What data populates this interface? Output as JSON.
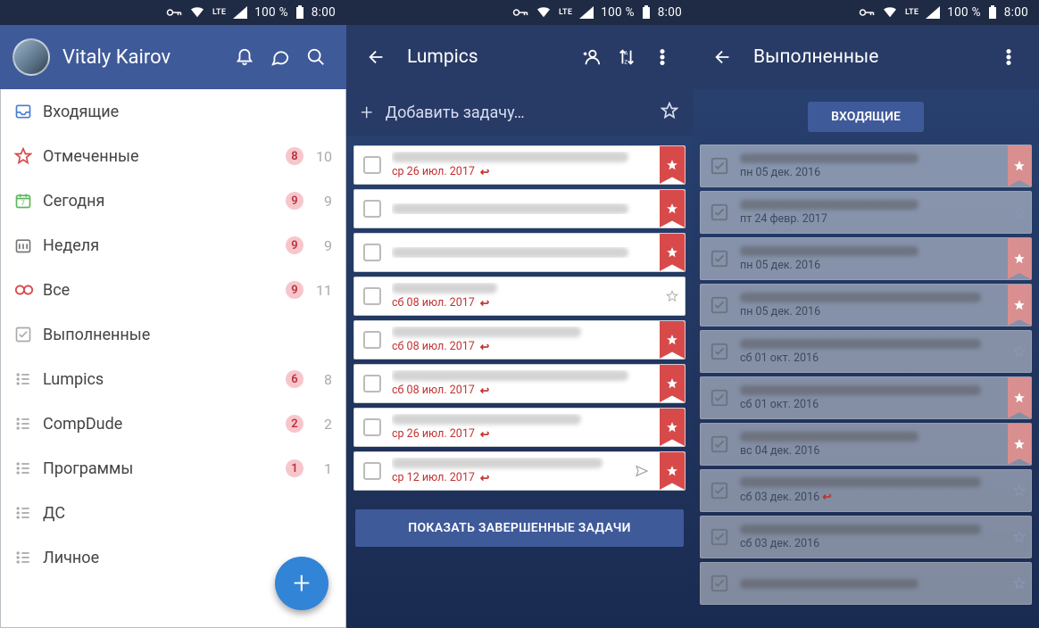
{
  "statusbar": {
    "lte": "LTE",
    "signal": "100 %",
    "time": "8:00"
  },
  "p1": {
    "user": "Vitaly Kairov",
    "sections": [
      {
        "icon": "inbox",
        "iconColor": "#4a7bd0",
        "label": "Входящие"
      },
      {
        "icon": "star",
        "iconColor": "#d84a4a",
        "label": "Отмеченные",
        "badge": "8",
        "count": "10"
      },
      {
        "icon": "today",
        "iconColor": "#5cb85c",
        "label": "Сегодня",
        "badge": "9",
        "count": "9"
      },
      {
        "icon": "week",
        "iconColor": "#888",
        "label": "Неделя",
        "badge": "9",
        "count": "9"
      },
      {
        "icon": "all",
        "iconColor": "#d84a4a",
        "label": "Все",
        "badge": "9",
        "count": "11"
      },
      {
        "icon": "done",
        "iconColor": "#aaa",
        "label": "Выполненные"
      },
      {
        "icon": "list",
        "iconColor": "#aaa",
        "label": "Lumpics",
        "badge": "6",
        "count": "8"
      },
      {
        "icon": "list",
        "iconColor": "#aaa",
        "label": "CompDude",
        "badge": "2",
        "count": "2"
      },
      {
        "icon": "list",
        "iconColor": "#aaa",
        "label": "Программы",
        "badge": "1",
        "count": "1"
      },
      {
        "icon": "list",
        "iconColor": "#aaa",
        "label": "ДС"
      },
      {
        "icon": "list",
        "iconColor": "#aaa",
        "label": "Личное"
      }
    ]
  },
  "p2": {
    "title": "Lumpics",
    "add": "Добавить задачу…",
    "tasks": [
      {
        "date": "ср 26 июл. 2017",
        "repeat": true,
        "star": "red",
        "blur": "long"
      },
      {
        "date": "",
        "repeat": false,
        "star": "red",
        "blur": "long"
      },
      {
        "date": "",
        "repeat": false,
        "star": "red",
        "blur": "long"
      },
      {
        "date": "сб 08 июл. 2017",
        "repeat": true,
        "star": "hollow",
        "blur": "short"
      },
      {
        "date": "сб 08 июл. 2017",
        "repeat": true,
        "star": "red",
        "blur": "mid"
      },
      {
        "date": "сб 08 июл. 2017",
        "repeat": true,
        "star": "red",
        "blur": "long"
      },
      {
        "date": "ср 26 июл. 2017",
        "repeat": true,
        "star": "red",
        "blur": "mid"
      },
      {
        "date": "ср 12 июл. 2017",
        "repeat": true,
        "star": "red",
        "blur": "long",
        "send": true
      }
    ],
    "showCompleted": "ПОКАЗАТЬ ЗАВЕРШЕННЫЕ ЗАДАЧИ"
  },
  "p3": {
    "title": "Выполненные",
    "chip": "ВХОДЯЩИЕ",
    "items": [
      {
        "date": "пн 05 дек. 2016",
        "star": "muted",
        "blur": "mid"
      },
      {
        "date": "пт 24 февр. 2017",
        "star": "hollow",
        "blur": "short"
      },
      {
        "date": "пн 05 дек. 2016",
        "star": "muted",
        "blur": "mid"
      },
      {
        "date": "пн 05 дек. 2016",
        "star": "muted",
        "blur": "long"
      },
      {
        "date": "сб 01 окт. 2016",
        "star": "hollow",
        "blur": "long"
      },
      {
        "date": "сб 01 окт. 2016",
        "star": "muted",
        "blur": "long"
      },
      {
        "date": "вс 04 дек. 2016",
        "star": "muted",
        "blur": "mid"
      },
      {
        "date": "сб 03 дек. 2016",
        "star": "hollow",
        "blur": "long",
        "repeat": true
      },
      {
        "date": "сб 03 дек. 2016",
        "star": "hollow",
        "blur": "long"
      },
      {
        "date": "",
        "star": "hollow",
        "blur": "mid"
      }
    ]
  }
}
